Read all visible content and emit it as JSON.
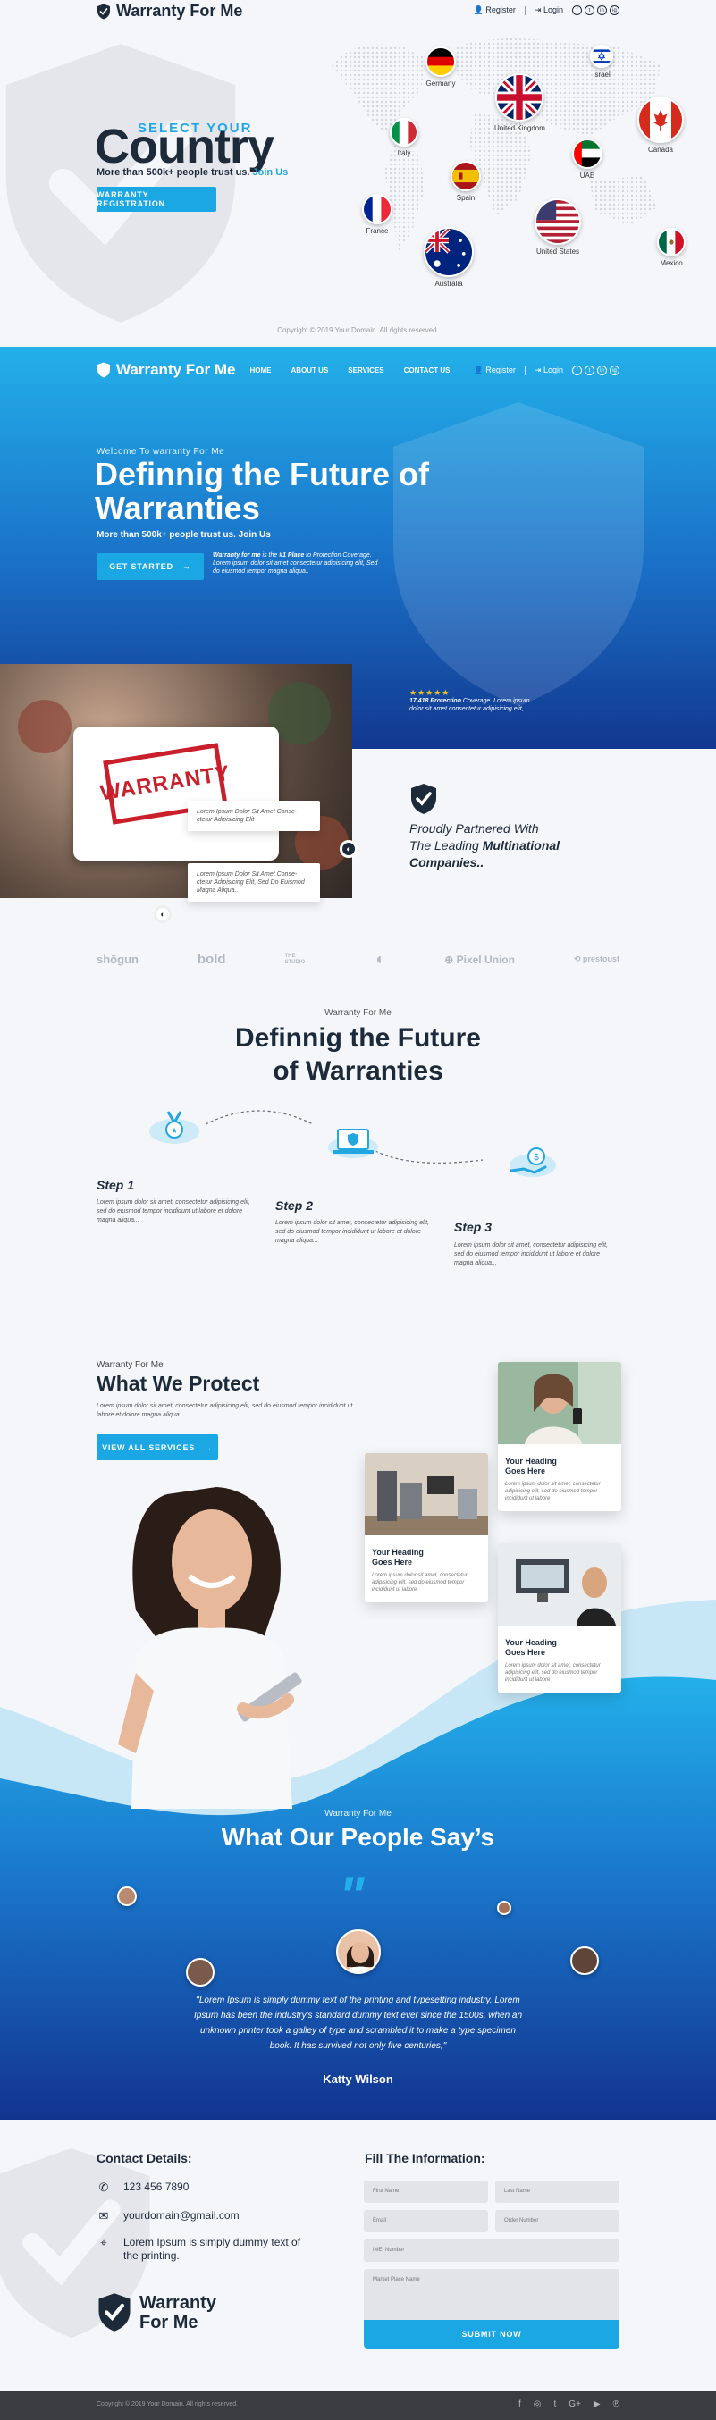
{
  "brand": {
    "name": "Warranty For Me",
    "name_line1": "Warranty",
    "name_line2": "For Me"
  },
  "top_links": {
    "register": "Register",
    "login": "Login"
  },
  "socials": [
    "f",
    "t",
    "in",
    "ig"
  ],
  "select_country": {
    "small": "SELECT YOUR",
    "big": "Country",
    "sub_text": "More than 500k+ people trust us.",
    "sub_link": "Join Us",
    "button": "WARRANTY REGISTRATION",
    "copyright": "Copyright © 2019 Your Domain. All rights reserved."
  },
  "countries": [
    {
      "name": "Germany"
    },
    {
      "name": "Israel"
    },
    {
      "name": "United Kingdom"
    },
    {
      "name": "Italy"
    },
    {
      "name": "Canada"
    },
    {
      "name": "UAE"
    },
    {
      "name": "Spain"
    },
    {
      "name": "France"
    },
    {
      "name": "United States"
    },
    {
      "name": "Australia"
    },
    {
      "name": "Mexico"
    }
  ],
  "nav": {
    "items": [
      "HOME",
      "ABOUT US",
      "SERVICES",
      "CONTACT US"
    ]
  },
  "hero": {
    "welcome": "Welcome To warranty For Me",
    "title": "Definnig the Future of Warranties",
    "sub_text": "More than 500k+ people trust us.",
    "sub_link": "Join Us",
    "button": "GET STARTED",
    "note_brand": "Warranty for me",
    "note_mid": " is the ",
    "note_bold": "#1 Place",
    "note_rest": " to Protection Coverage. Lorem ipsum dolor sit amet consectetur adipisicing elit, Sed do eiusmod tempor magna aliqua..",
    "stamp": "WARRANTY",
    "callout1": "Lorem Ipsum Dolor Sit Amet Conse- ctetur Adipisicing Elit",
    "callout2": "Lorem Ipsum Dolor Sit Amet Conse- ctetur Adipisicing Elit, Sed Do Euismod Magna Aliqua..",
    "stars": "★★★★★",
    "stars_bold": "17,418 Protection",
    "stars_rest": " Coverage. Lorem ipsum dolor sit amet consectetur adipisicing elit,"
  },
  "partners": {
    "line1": "Proudly Partnered With",
    "line2": "The Leading",
    "line2_bold": "Multinational",
    "line3": "Companies..",
    "brands": [
      "shōgun",
      "bold",
      "THE STUDIO",
      "◐",
      "⊕ Pixel Union",
      "⟲ prestoust"
    ]
  },
  "steps": {
    "kicker": "Warranty For Me",
    "title_line1": "Definnig the Future",
    "title_line2": "of Warranties",
    "items": [
      {
        "title": "Step 1",
        "text": "Lorem ipsum dolor sit amet, consectetur adipisicing elit, sed do eiusmod tempor incididunt ut labore et dolore magna aliqua..."
      },
      {
        "title": "Step 2",
        "text": "Lorem ipsum dolor sit amet, consectetur adipisicing elit, sed do eiusmod tempor incididunt ut labore et dolore magna aliqua..."
      },
      {
        "title": "Step 3",
        "text": "Lorem ipsum dolor sit amet, consectetur adipisicing elit, sed do eiusmod tempor incididunt ut labore et dolore magna aliqua..."
      }
    ]
  },
  "protect": {
    "kicker": "Warranty For Me",
    "title": "What We Protect",
    "text": "Lorem ipsum dolor sit amet, consectetur adipisicing elit, sed do eiusmod tempor incididunt ut labore et dolore magna aliqua.",
    "button": "VIEW ALL SERVICES",
    "cards": [
      {
        "title": "Your Heading Goes Here",
        "text": "Lorem ipsum dolor sit amet, consectetur adipisicing elit, sed do eiusmod tempor incididunt ut labore"
      },
      {
        "title": "Your Heading Goes Here",
        "text": "Lorem ipsum dolor sit amet, consectetur adipisicing elit, sed do eiusmod tempor incididunt ut labore"
      },
      {
        "title": "Your Heading Goes Here",
        "text": "Lorem ipsum dolor sit amet, consectetur adipisicing elit, sed do eiusmod tempor incididunt ut labore"
      }
    ]
  },
  "testimonials": {
    "kicker": "Warranty For Me",
    "title": "What Our People Say’s",
    "quote_mark": "\"",
    "quote": "\"Lorem Ipsum is simply dummy text of the printing and typesetting industry. Lorem Ipsum has been the industry's standard dummy text ever since the 1500s, when an unknown printer took a galley of type and scrambled it to make a type specimen book. It has survived not only five centuries,\"",
    "name": "Katty Wilson"
  },
  "contact": {
    "title": "Contact Details:",
    "phone": "123 456 7890",
    "email": "yourdomain@gmail.com",
    "address": "Lorem Ipsum is simply dummy text of the printing."
  },
  "form": {
    "title": "Fill The Information:",
    "first_name": "First Name",
    "last_name": "Last Name",
    "email": "Email",
    "order_number": "Order Number",
    "imei": "IMEI Number",
    "market_place": "Market Place Name",
    "submit": "SUBMIT NOW"
  },
  "footer": {
    "copyright": "Copyright © 2019 Your Domain. All rights reserved.",
    "socials": [
      "f",
      "◎",
      "t",
      "G+",
      "▶",
      "℗"
    ]
  },
  "colors": {
    "accent": "#1ba7e3",
    "dark": "#1d2a3a",
    "hero_top": "#23b0ea",
    "hero_bottom": "#12378f"
  }
}
